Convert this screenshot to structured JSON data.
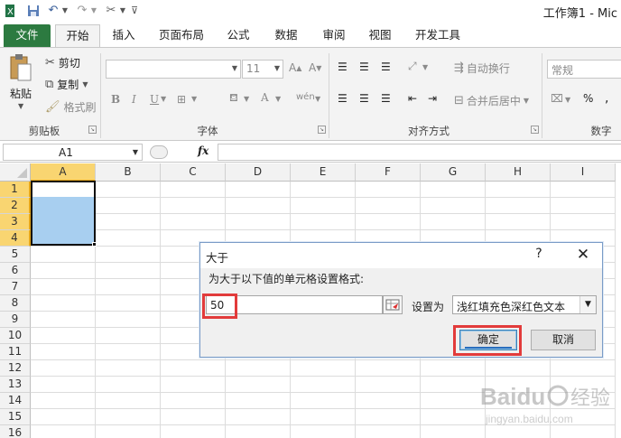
{
  "titlebar": {
    "app_title": "工作簿1 - Mic",
    "icons": [
      "save-icon",
      "undo-icon",
      "redo-icon",
      "customize-icon"
    ]
  },
  "tabs": [
    {
      "label": "文件"
    },
    {
      "label": "开始"
    },
    {
      "label": "插入"
    },
    {
      "label": "页面布局"
    },
    {
      "label": "公式"
    },
    {
      "label": "数据"
    },
    {
      "label": "审阅"
    },
    {
      "label": "视图"
    },
    {
      "label": "开发工具"
    }
  ],
  "ribbon": {
    "clipboard": {
      "paste": "粘贴",
      "cut": "剪切",
      "copy": "复制",
      "format_painter": "格式刷",
      "group": "剪贴板"
    },
    "font": {
      "size": "11",
      "group": "字体"
    },
    "alignment": {
      "wrap": "自动换行",
      "merge": "合并后居中",
      "group": "对齐方式"
    },
    "number": {
      "format": "常规",
      "group": "数字"
    }
  },
  "formula_bar": {
    "name_box": "A1",
    "fx": "fx",
    "value": ""
  },
  "grid": {
    "columns": [
      "A",
      "B",
      "C",
      "D",
      "E",
      "F",
      "G",
      "H",
      "I"
    ],
    "rows": [
      "1",
      "2",
      "3",
      "4",
      "5",
      "6",
      "7",
      "8",
      "9",
      "10",
      "11",
      "12",
      "13",
      "14",
      "15",
      "16"
    ],
    "selection": "A1:A4"
  },
  "dialog": {
    "title": "大于",
    "help": "?",
    "close": "✕",
    "prompt": "为大于以下值的单元格设置格式:",
    "value": "50",
    "setas_label": "设置为",
    "format_value": "浅红填充色深红色文本",
    "ok": "确定",
    "cancel": "取消"
  },
  "colors": {
    "file_tab": "#2c7a40",
    "selection_fill": "#a8cff0",
    "highlight": "#e23b3b",
    "header_selected": "#f9d571"
  },
  "watermark": {
    "brand": "Baidu",
    "cn": "经验",
    "url": "jingyan.baidu.com"
  }
}
